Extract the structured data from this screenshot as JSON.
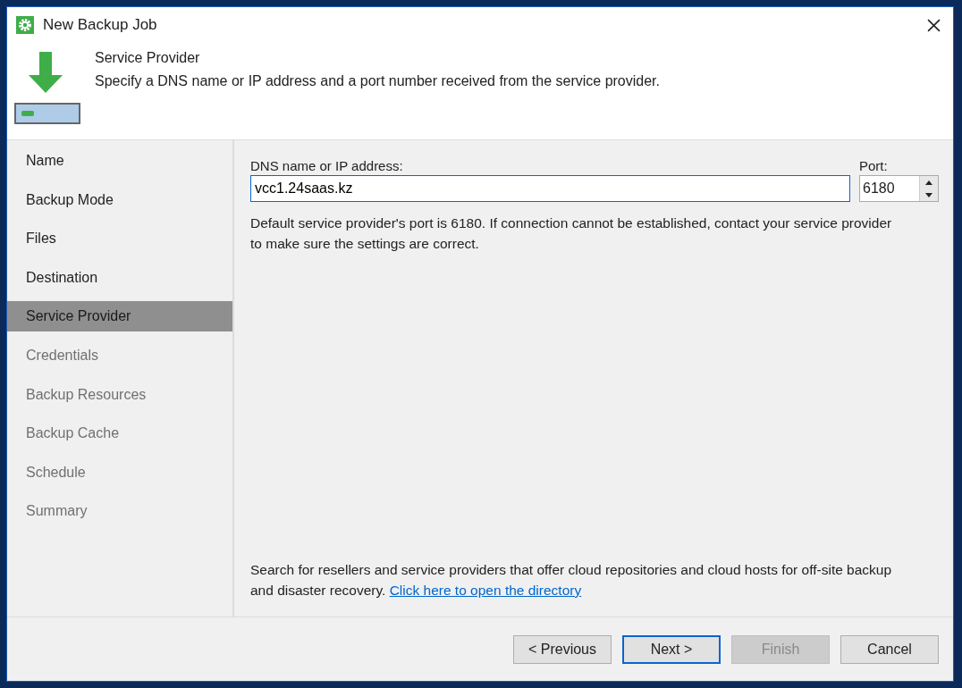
{
  "window": {
    "title": "New Backup Job"
  },
  "header": {
    "title": "Service Provider",
    "subtitle": "Specify a DNS name or IP address and a port number received from the service provider."
  },
  "steps": [
    {
      "label": "Name",
      "selected": false,
      "disabled": false
    },
    {
      "label": "Backup Mode",
      "selected": false,
      "disabled": false
    },
    {
      "label": "Files",
      "selected": false,
      "disabled": false
    },
    {
      "label": "Destination",
      "selected": false,
      "disabled": false
    },
    {
      "label": "Service Provider",
      "selected": true,
      "disabled": false
    },
    {
      "label": "Credentials",
      "selected": false,
      "disabled": true
    },
    {
      "label": "Backup Resources",
      "selected": false,
      "disabled": true
    },
    {
      "label": "Backup Cache",
      "selected": false,
      "disabled": true
    },
    {
      "label": "Schedule",
      "selected": false,
      "disabled": true
    },
    {
      "label": "Summary",
      "selected": false,
      "disabled": true
    }
  ],
  "address": {
    "label": "DNS name or IP address:",
    "value": "vcc1.24saas.kz"
  },
  "port": {
    "label": "Port:",
    "value": "6180"
  },
  "note": "Default service provider's port is 6180. If connection cannot be established, contact your service provider to make sure the settings are correct.",
  "directory": {
    "text": "Search for resellers and service providers that offer cloud repositories and cloud hosts for off-site backup and disaster recovery.",
    "link": "Click here to open the directory"
  },
  "buttons": [
    {
      "label": "< Previous",
      "default": false,
      "disabled": false
    },
    {
      "label": "Next >",
      "default": true,
      "disabled": false
    },
    {
      "label": "Finish",
      "default": false,
      "disabled": true
    },
    {
      "label": "Cancel",
      "default": false,
      "disabled": false
    }
  ]
}
